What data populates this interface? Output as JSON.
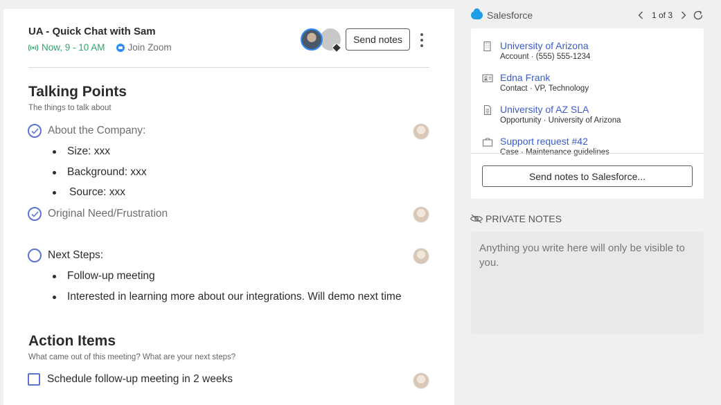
{
  "meeting": {
    "title": "UA - Quick Chat with Sam",
    "time": "Now, 9 - 10 AM",
    "join_label": "Join Zoom",
    "send_notes_label": "Send notes"
  },
  "talking_points": {
    "heading": "Talking Points",
    "subtitle": "The things to talk about",
    "items": [
      {
        "label": "About the Company:",
        "checked": true,
        "bullets": [
          "Size: xxx",
          "Background: xxx",
          "Source: xxx"
        ]
      },
      {
        "label": "Original Need/Frustration",
        "checked": true,
        "bullets": []
      },
      {
        "label": "Next Steps:",
        "checked": false,
        "bullets": [
          "Follow-up meeting",
          "Interested in learning more about our integrations. Will demo next time"
        ]
      }
    ]
  },
  "action_items": {
    "heading": "Action Items",
    "subtitle": "What came out of this meeting? What are your next steps?",
    "items": [
      {
        "label": "Schedule follow-up meeting in 2 weeks",
        "checked": false
      }
    ]
  },
  "salesforce": {
    "label": "Salesforce",
    "pager": "1 of 3",
    "records": [
      {
        "icon": "building-icon",
        "title": "University of Arizona",
        "desc": "Account · (555) 555-1234"
      },
      {
        "icon": "contact-card-icon",
        "title": "Edna Frank",
        "desc": "Contact · VP, Technology"
      },
      {
        "icon": "document-icon",
        "title": "University of AZ SLA",
        "desc": "Opportunity · University of Arizona"
      },
      {
        "icon": "briefcase-icon",
        "title": "Support request #42",
        "desc": "Case · Maintenance guidelines"
      }
    ],
    "send_button": "Send notes to Salesforce..."
  },
  "private_notes": {
    "heading": "PRIVATE NOTES",
    "placeholder": "Anything you write here will only be visible to you."
  },
  "colors": {
    "accent": "#5b72d6",
    "live_green": "#2ea86a",
    "link_blue": "#3b5bcc",
    "salesforce_blue": "#1e9ee6",
    "zoom_blue": "#2d8cff"
  }
}
